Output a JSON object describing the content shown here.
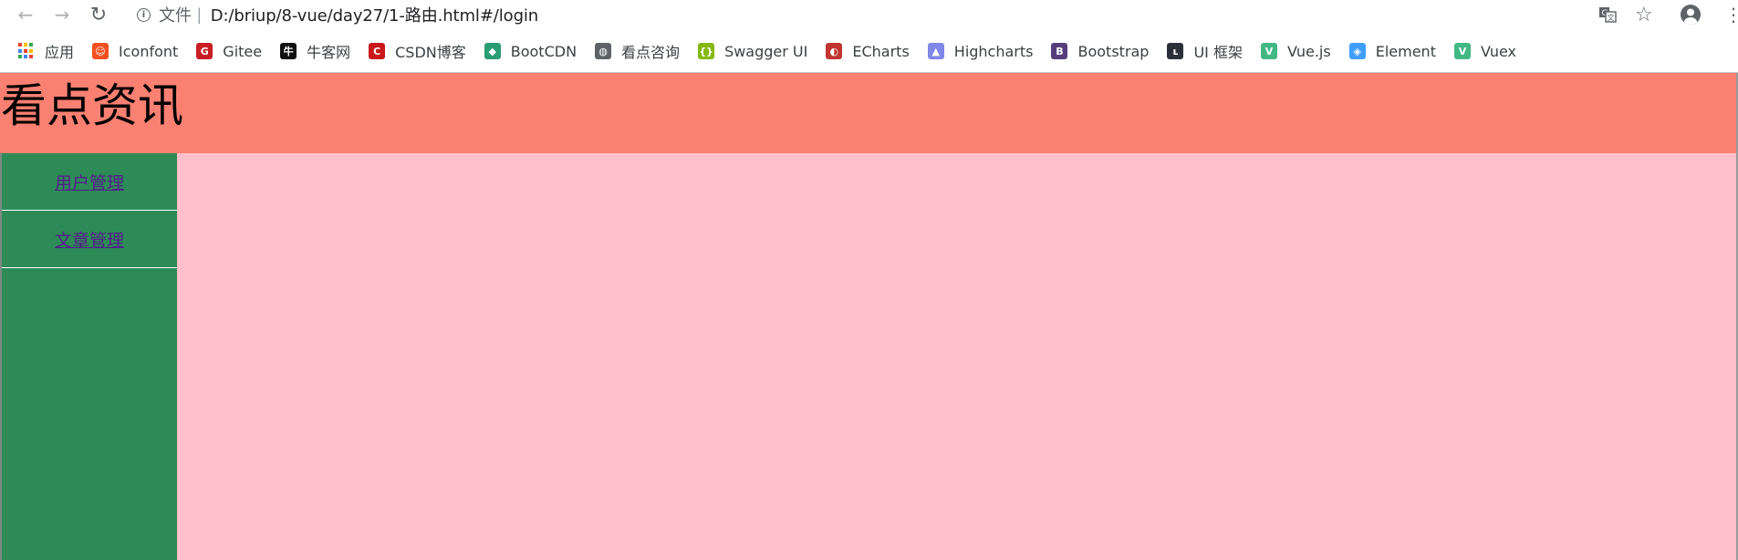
{
  "browser": {
    "url_label": "文件",
    "url_sep": "|",
    "url": "D:/briup/8-vue/day27/1-路由.html#/login"
  },
  "bookmarks": [
    {
      "name": "bm-apps",
      "label": "应用",
      "icon": "apps-grid-icon",
      "color": "#4285f4",
      "glyph": ""
    },
    {
      "name": "bm-iconfont",
      "label": "Iconfont",
      "icon": "iconfont-icon",
      "color": "#f25021",
      "glyph": "☺"
    },
    {
      "name": "bm-gitee",
      "label": "Gitee",
      "icon": "gitee-icon",
      "color": "#c71d23",
      "glyph": "G"
    },
    {
      "name": "bm-nowcoder",
      "label": "牛客网",
      "icon": "nowcoder-icon",
      "color": "#111111",
      "glyph": "牛"
    },
    {
      "name": "bm-csdn",
      "label": "CSDN博客",
      "icon": "csdn-icon",
      "color": "#c9191a",
      "glyph": "C"
    },
    {
      "name": "bm-bootcdn",
      "label": "BootCDN",
      "icon": "bootcdn-icon",
      "color": "#2a9d72",
      "glyph": "◆"
    },
    {
      "name": "bm-kandian",
      "label": "看点咨询",
      "icon": "globe-icon",
      "color": "#5f6368",
      "glyph": "◍"
    },
    {
      "name": "bm-swagger",
      "label": "Swagger UI",
      "icon": "swagger-icon",
      "color": "#85b811",
      "glyph": "{}"
    },
    {
      "name": "bm-echarts",
      "label": "ECharts",
      "icon": "echarts-icon",
      "color": "#c23531",
      "glyph": "◐"
    },
    {
      "name": "bm-highcharts",
      "label": "Highcharts",
      "icon": "highcharts-icon",
      "color": "#8087e8",
      "glyph": "▲"
    },
    {
      "name": "bm-bootstrap",
      "label": "Bootstrap",
      "icon": "bootstrap-icon",
      "color": "#563d7c",
      "glyph": "B"
    },
    {
      "name": "bm-ui",
      "label": "UI 框架",
      "icon": "ui-framework-icon",
      "color": "#2b2f3a",
      "glyph": "ʟ"
    },
    {
      "name": "bm-vuejs",
      "label": "Vue.js",
      "icon": "vue-icon",
      "color": "#41b883",
      "glyph": "V"
    },
    {
      "name": "bm-element",
      "label": "Element",
      "icon": "element-icon",
      "color": "#409eff",
      "glyph": "◈"
    },
    {
      "name": "bm-vuex",
      "label": "Vuex",
      "icon": "vuex-icon",
      "color": "#41b883",
      "glyph": "V"
    }
  ],
  "page": {
    "title": "看点资讯",
    "header_color": "#fa8072",
    "sidebar_color": "#2e8b57",
    "main_color": "#ffc0cb",
    "nav": [
      {
        "label": "用户管理"
      },
      {
        "label": "文章管理"
      }
    ]
  }
}
